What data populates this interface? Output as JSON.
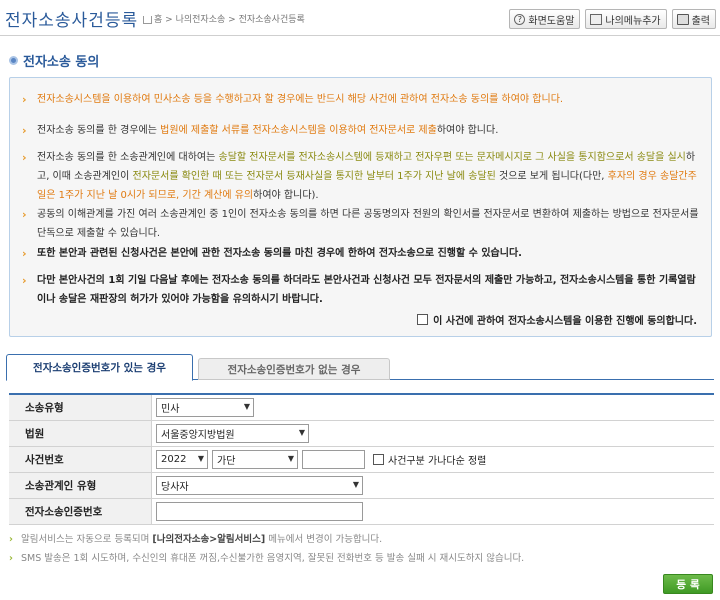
{
  "header": {
    "title": "전자소송사건등록",
    "breadcrumb": [
      "홈",
      "나의전자소송",
      "전자소송사건등록"
    ],
    "breadcrumb_sep": ">",
    "buttons": {
      "help": "화면도움말",
      "add_menu": "나의메뉴추가",
      "print": "출력"
    }
  },
  "section": {
    "title": "전자소송 동의"
  },
  "notice": {
    "items": [
      {
        "parts": [
          {
            "t": "전자소송시스템을 이용하여 민사소송 등을 수행하고자 할 경우에는 반드시 해당 사건에 관하여 전자소송 동의를 하여야 합니다.",
            "c": "orange"
          }
        ]
      },
      {
        "parts": [
          {
            "t": "전자소송 동의를 한 경우에는 ",
            "c": ""
          },
          {
            "t": "법원에 제출할 서류를 전자소송시스템을 이용하여 전자문서로 제출",
            "c": "orange"
          },
          {
            "t": "하여야 합니다.",
            "c": ""
          }
        ]
      },
      {
        "parts": [
          {
            "t": "전자소송 동의를 한 소송관계인에 대하여는 ",
            "c": ""
          },
          {
            "t": "송달할 전자문서를 전자소송시스템에 등재하고 전자우편 또는 문자메시지로 그 사실을 통지",
            "c": "olive"
          },
          {
            "t": "함으로서 송달을 실시",
            "c": "olive"
          },
          {
            "t": "하고, 이때 소송관계인이 ",
            "c": ""
          },
          {
            "t": "전자문서를 확인한 때 또는 전자문서 등재사실을 통지한 날부터 1주가 지난 날에 송달된",
            "c": "olive"
          },
          {
            "t": " 것으로 보게 됩니다(다만, ",
            "c": ""
          },
          {
            "t": "후자의 경우 송달간주일은 1주가 지난 날 0시가 되므로, 기간 계산에 유의",
            "c": "orange"
          },
          {
            "t": "하여야 합니다).",
            "c": ""
          }
        ]
      },
      {
        "parts": [
          {
            "t": "공동의 이해관계를 가진 여러 소송관계인 중 1인이 전자소송 동의를 하면 다른 공동명의자 전원의 확인서를 전자문서로 변환하여 제출하는 방법으로 전자문서를 단독으로 제출할 수 있습니다.",
            "c": ""
          }
        ]
      },
      {
        "parts": [
          {
            "t": "또한 본안과 관련된 신청사건은 본안에 관한 전자소송 동의를 마친 경우에 한하여 전자소송으로 진행할 수 있습니다.",
            "c": "bold"
          }
        ]
      },
      {
        "parts": [
          {
            "t": "다만 본안사건의 1회 기일 다음날 후에는 전자소송 동의를 하더라도 본안사건과 신청사건 모두 전자문서의 제출만 가능하고, 전자소송시스템을 통한 기록열람이나 송달은 재판장의 허가가 있어야 가능함을 유의하시기 바랍니다.",
            "c": "bold"
          }
        ]
      }
    ],
    "agree_label": "이 사건에 관하여 전자소송시스템을 이용한 진행에 동의합니다."
  },
  "tabs": [
    {
      "label": "전자소송인증번호가 있는 경우",
      "active": true
    },
    {
      "label": "전자소송인증번호가 없는 경우",
      "active": false
    }
  ],
  "form": {
    "case_type": {
      "label": "소송유형",
      "value": "민사"
    },
    "court": {
      "label": "법원",
      "value": "서울중앙지방법원"
    },
    "case_number": {
      "label": "사건번호",
      "year": "2022",
      "code": "가단",
      "number": "",
      "sort_label": "사건구분 가나다순 정렬"
    },
    "party_type": {
      "label": "소송관계인 유형",
      "value": "당사자"
    },
    "auth_number": {
      "label": "전자소송인증번호",
      "value": ""
    }
  },
  "notes": [
    {
      "before": "알림서비스는 자동으로 등록되며 ",
      "strong": "[나의전자소송>알림서비스]",
      "after": " 메뉴에서 변경이 가능합니다."
    },
    {
      "before": "SMS 발송은 1회 시도하며, 수신인의 휴대폰 꺼짐,수신불가한 음영지역, 잘못된 전화번호 등 발송 실패 시 재시도하지 않습니다.",
      "strong": "",
      "after": ""
    }
  ],
  "submit_label": "등록",
  "icons": {
    "notice_bullet": "chevron-right-icon",
    "section_bullet": "circle-bullet-icon",
    "select_arrow": "caret-down-icon"
  },
  "colors": {
    "accent": "#3a6fae",
    "title": "#2a5a9a",
    "orange": "#e07a10",
    "olive": "#8a8a10",
    "submit": "#4fa82e"
  }
}
